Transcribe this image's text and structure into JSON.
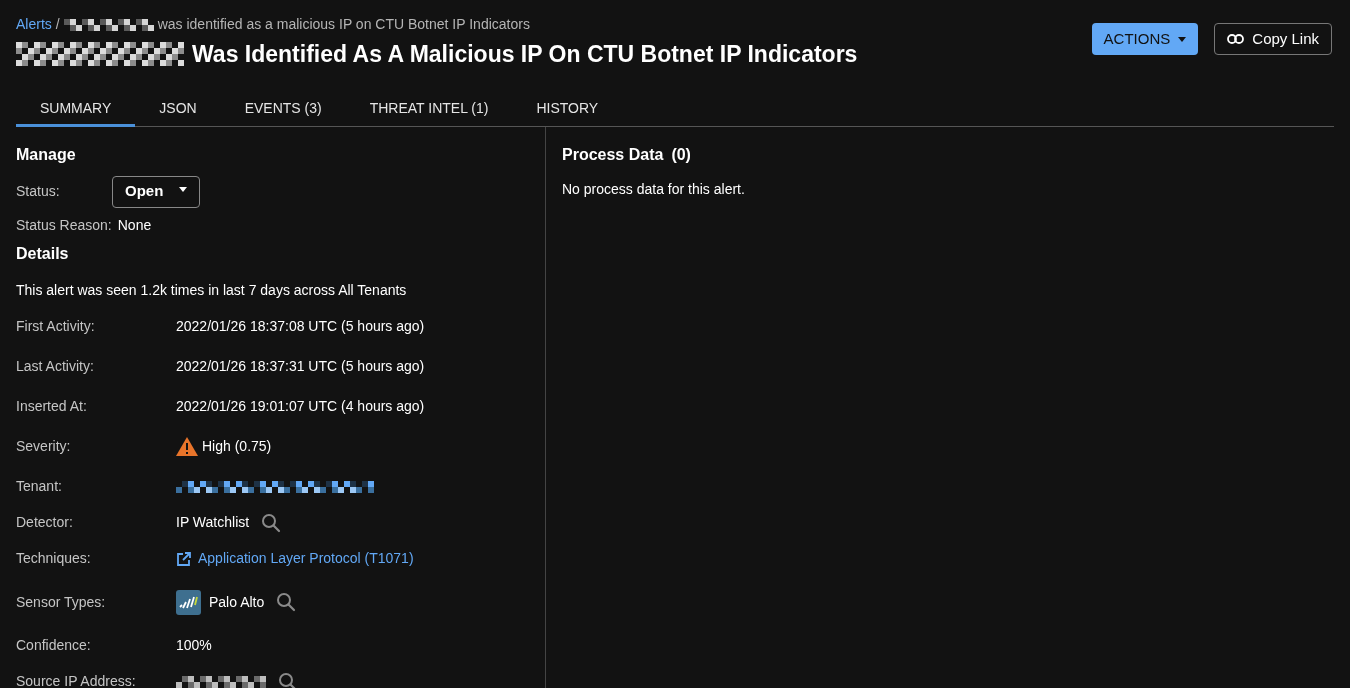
{
  "breadcrumb": {
    "link": "Alerts",
    "separator": "/",
    "text": "was identified as a malicious IP on CTU Botnet IP Indicators"
  },
  "title": "Was Identified As A Malicious IP On CTU Botnet IP Indicators",
  "actions": [
    {
      "label": "ACTIONS",
      "kind": "dropdown"
    },
    {
      "label": "Copy Link",
      "kind": "link"
    }
  ],
  "tabs": [
    {
      "label": "SUMMARY",
      "selected": true
    },
    {
      "label": "JSON",
      "selected": false
    },
    {
      "label": "EVENTS (3)",
      "selected": false
    },
    {
      "label": "THREAT INTEL (1)",
      "selected": false
    },
    {
      "label": "HISTORY",
      "selected": false
    }
  ],
  "manage": {
    "heading": "Manage",
    "status_label": "Status:",
    "status_value": "Open",
    "reason_label": "Status Reason:",
    "reason_value": "None"
  },
  "details": {
    "heading": "Details",
    "summary": "This alert was seen 1.2k times in last 7 days across All Tenants",
    "rows": [
      {
        "label": "First Activity:",
        "kind": "text",
        "value": "2022/01/26 18:37:08 UTC (5 hours ago)"
      },
      {
        "label": "Last Activity:",
        "kind": "text",
        "value": "2022/01/26 18:37:31 UTC (5 hours ago)"
      },
      {
        "label": "Inserted At:",
        "kind": "text",
        "value": "2022/01/26 19:01:07 UTC (4 hours ago)"
      },
      {
        "label": "Severity:",
        "kind": "severity",
        "value": "High (0.75)"
      },
      {
        "label": "Tenant:",
        "kind": "redacted"
      },
      {
        "label": "Detector:",
        "kind": "search",
        "value": "IP Watchlist"
      },
      {
        "label": "Techniques:",
        "kind": "link",
        "value": "Application Layer Protocol (T1071)"
      },
      {
        "label": "Sensor Types:",
        "kind": "sensor",
        "value": "Palo Alto"
      },
      {
        "label": "Confidence:",
        "kind": "text",
        "value": "100%"
      },
      {
        "label": "Source IP Address:",
        "kind": "redacted_search"
      }
    ]
  },
  "process": {
    "heading": "Process Data",
    "count": "(0)",
    "message": "No process data for this alert."
  }
}
